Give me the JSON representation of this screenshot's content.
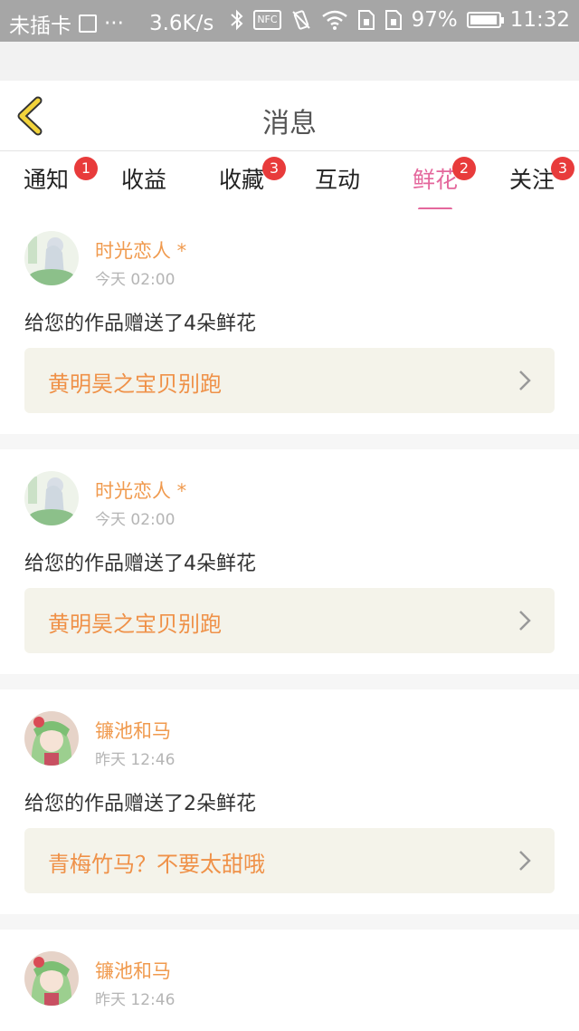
{
  "status_bar": {
    "carrier": "未插卡",
    "overflow": "···",
    "network_speed": "3.6K/s",
    "nfc": "NFC",
    "battery_percent": "97%",
    "battery_level": 0.97,
    "time": "11:32"
  },
  "header": {
    "title": "消息",
    "back_icon": "chevron-left-icon",
    "accent_color": "#e4679c",
    "back_color": "#f2d33b"
  },
  "tabs": [
    {
      "label": "通知",
      "badge": "1"
    },
    {
      "label": "收益",
      "badge": ""
    },
    {
      "label": "收藏",
      "badge": "3"
    },
    {
      "label": "互动",
      "badge": ""
    },
    {
      "label": "鲜花",
      "badge": "2",
      "active": true
    },
    {
      "label": "关注",
      "badge": "3"
    }
  ],
  "messages": [
    {
      "user": "时光恋人 *",
      "time": "今天 02:00",
      "text": "给您的作品赠送了4朵鲜花",
      "work": "黄明昊之宝贝别跑"
    },
    {
      "user": "时光恋人 *",
      "time": "今天 02:00",
      "text": "给您的作品赠送了4朵鲜花",
      "work": "黄明昊之宝贝别跑"
    },
    {
      "user": "镰池和马",
      "time": "昨天 12:46",
      "text": "给您的作品赠送了2朵鲜花",
      "work": "青梅竹马？不要太甜哦"
    },
    {
      "user": "镰池和马",
      "time": "昨天 12:46",
      "text": "",
      "work": ""
    }
  ]
}
